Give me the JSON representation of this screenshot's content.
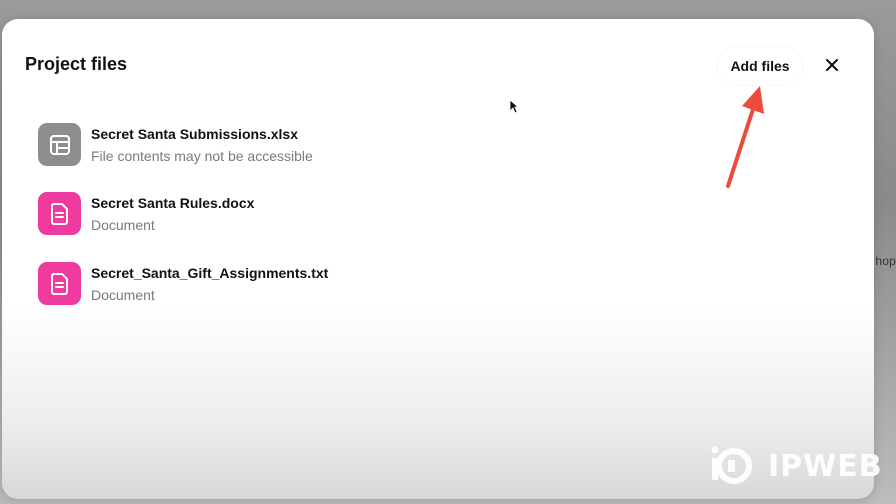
{
  "backdrop": {
    "right_edge_text": "hop"
  },
  "modal": {
    "title": "Project files",
    "add_files_label": "Add files",
    "close_icon": "close-icon"
  },
  "files": [
    {
      "name": "Secret Santa Submissions.xlsx",
      "subtitle": "File contents may not be accessible",
      "icon": "spreadsheet-icon",
      "icon_color": "#8e8e8e"
    },
    {
      "name": "Secret Santa Rules.docx",
      "subtitle": "Document",
      "icon": "document-icon",
      "icon_color": "#ef3aa0"
    },
    {
      "name": "Secret_Santa_Gift_Assignments.txt",
      "subtitle": "Document",
      "icon": "document-icon",
      "icon_color": "#ef3aa0"
    }
  ],
  "annotation": {
    "arrow_color": "#ee4b3f"
  },
  "watermark": {
    "text": "IPWEB"
  }
}
